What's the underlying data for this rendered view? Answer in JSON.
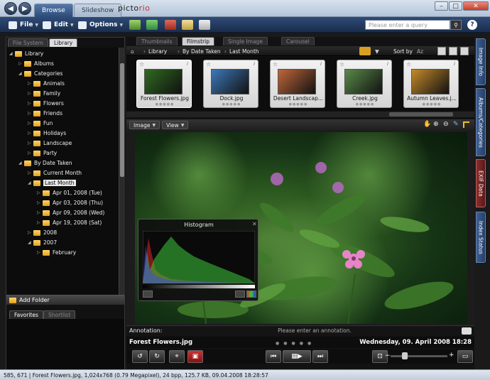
{
  "titlebar": {
    "tabs": [
      {
        "label": "Browse",
        "active": true
      },
      {
        "label": "Slideshow",
        "active": false
      }
    ],
    "logo_main": "picto",
    "logo_accent": "rio"
  },
  "toolbar": {
    "menus": [
      {
        "label": "File"
      },
      {
        "label": "Edit"
      },
      {
        "label": "Options"
      }
    ],
    "search_placeholder": "Please enter a query",
    "help_label": "?"
  },
  "left_panel": {
    "tabs": [
      {
        "label": "File System",
        "active": false
      },
      {
        "label": "Library",
        "active": true
      }
    ],
    "tree": [
      {
        "label": "Library",
        "level": 0,
        "expanded": true
      },
      {
        "label": "Albums",
        "level": 1,
        "expanded": false
      },
      {
        "label": "Categories",
        "level": 1,
        "expanded": true
      },
      {
        "label": "Animals",
        "level": 2,
        "expanded": false
      },
      {
        "label": "Family",
        "level": 2,
        "expanded": false
      },
      {
        "label": "Flowers",
        "level": 2,
        "expanded": false
      },
      {
        "label": "Friends",
        "level": 2,
        "expanded": false
      },
      {
        "label": "Fun",
        "level": 2,
        "expanded": false
      },
      {
        "label": "Holidays",
        "level": 2,
        "expanded": false
      },
      {
        "label": "Landscape",
        "level": 2,
        "expanded": false
      },
      {
        "label": "Party",
        "level": 2,
        "expanded": false
      },
      {
        "label": "By Date Taken",
        "level": 1,
        "expanded": true
      },
      {
        "label": "Current Month",
        "level": 2,
        "expanded": false
      },
      {
        "label": "Last Month",
        "level": 2,
        "expanded": true,
        "selected": true
      },
      {
        "label": "Apr 01, 2008 (Tue)",
        "level": 3,
        "expanded": false
      },
      {
        "label": "Apr 03, 2008 (Thu)",
        "level": 3,
        "expanded": false
      },
      {
        "label": "Apr 09, 2008 (Wed)",
        "level": 3,
        "expanded": false
      },
      {
        "label": "Apr 19, 2008 (Sat)",
        "level": 3,
        "expanded": false
      },
      {
        "label": "2008",
        "level": 2,
        "expanded": false
      },
      {
        "label": "2007",
        "level": 2,
        "expanded": true
      },
      {
        "label": "February",
        "level": 3,
        "expanded": false
      }
    ],
    "add_folder_label": "Add Folder",
    "bottom_tabs": [
      {
        "label": "Favorites",
        "active": true
      },
      {
        "label": "Shortlist",
        "active": false
      }
    ]
  },
  "view_tabs": [
    {
      "label": "Thumbnails",
      "active": false
    },
    {
      "label": "Filmstrip",
      "active": true
    },
    {
      "label": "Single Image",
      "active": false
    },
    {
      "label": "Carousel",
      "active": false
    }
  ],
  "breadcrumb": [
    "Library",
    "By Date Taken",
    "Last Month"
  ],
  "sort_label": "Sort by",
  "sort_value": "Az",
  "filmstrip": [
    {
      "name": "Forest Flowers.jpg",
      "color": "#2f6a1f"
    },
    {
      "name": "Dock.jpg",
      "color": "#3d78b8"
    },
    {
      "name": "Desert Landscap...",
      "color": "#c0663a"
    },
    {
      "name": "Creek.jpg",
      "color": "#5a8a4a"
    },
    {
      "name": "Autumn Leaves.j...",
      "color": "#c58a2a"
    }
  ],
  "viewer": {
    "menus": [
      {
        "label": "Image"
      },
      {
        "label": "View"
      }
    ],
    "histogram_title": "Histogram"
  },
  "annotation": {
    "label": "Annotation:",
    "placeholder": "Please enter an annotation."
  },
  "info": {
    "filename": "Forest Flowers.jpg",
    "date": "Wednesday, 09. April 2008 18:28"
  },
  "side_tabs": [
    "Image Info",
    "Albums/Categories",
    "EXIF Data",
    "Index Status"
  ],
  "statusbar": "585, 671 | Forest Flowers.jpg, 1,024x768 (0.79 Megapixel), 24 bpp, 125.7 KB, 09.04.2008 18:28:57"
}
